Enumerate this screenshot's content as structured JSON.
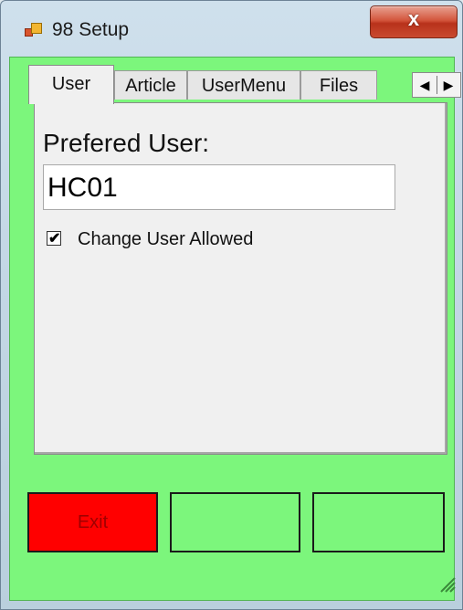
{
  "window": {
    "title": "98 Setup",
    "close_glyph": "x",
    "app_icon": "app-window-icon"
  },
  "tabs": [
    {
      "label": "User",
      "active": true
    },
    {
      "label": "Article",
      "active": false
    },
    {
      "label": "UserMenu",
      "active": false
    },
    {
      "label": "Files",
      "active": false
    }
  ],
  "tab_scroll": {
    "left": "◀",
    "right": "▶"
  },
  "user_tab": {
    "prefered_user_label": "Prefered User:",
    "prefered_user_value": "HC01",
    "change_user_allowed_label": "Change User Allowed",
    "change_user_allowed_checked": true,
    "check_glyph": "✔"
  },
  "buttons": {
    "exit": "Exit",
    "button2": "",
    "button3": ""
  },
  "colors": {
    "client_bg": "#7cf67c",
    "exit_bg": "#ff0000",
    "exit_text": "#a00000",
    "close_btn": "#c94a30"
  }
}
